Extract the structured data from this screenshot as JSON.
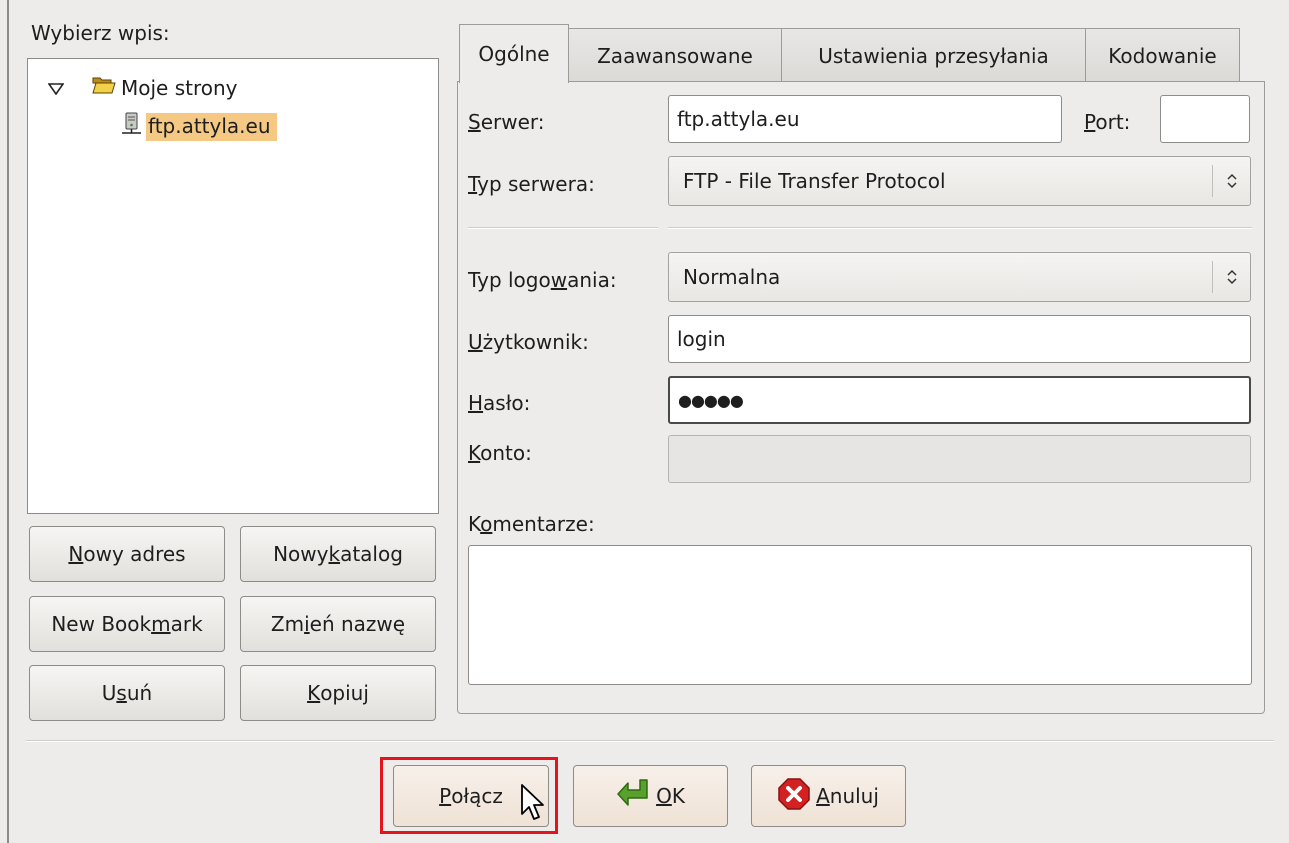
{
  "tree": {
    "heading": "Wybierz wpis:",
    "root": {
      "label": "Moje strony",
      "expanded": true
    },
    "site": {
      "label": "ftp.attyla.eu",
      "selected": true
    }
  },
  "buttons": {
    "new_site": {
      "pre": "",
      "u": "N",
      "post": "owy adres"
    },
    "new_folder": {
      "pre": "Nowy ",
      "u": "k",
      "post": "atalog"
    },
    "new_bookmark": {
      "pre": "New Book",
      "u": "m",
      "post": "ark"
    },
    "rename": {
      "pre": "Zm",
      "u": "i",
      "post": "eń nazwę"
    },
    "delete": {
      "pre": "U",
      "u": "s",
      "post": "uń"
    },
    "copy": {
      "pre": "",
      "u": "K",
      "post": "opiuj"
    }
  },
  "tabs": [
    "Ogólne",
    "Zaawansowane",
    "Ustawienia przesyłania",
    "Kodowanie"
  ],
  "form": {
    "server_label": {
      "pre": "",
      "u": "S",
      "post": "erwer:"
    },
    "server_value": "ftp.attyla.eu",
    "port_label": {
      "pre": "",
      "u": "P",
      "post": "ort:"
    },
    "port_value": "",
    "server_type_label": {
      "pre": "",
      "u": "T",
      "post": "yp serwera:"
    },
    "server_type_value": "FTP - File Transfer Protocol",
    "logon_type_label": {
      "pre": "Typ logo",
      "u": "w",
      "post": "ania:"
    },
    "logon_type_value": "Normalna",
    "user_label": {
      "pre": "",
      "u": "U",
      "post": "żytkownik:"
    },
    "user_value": "login",
    "password_label": {
      "pre": "",
      "u": "H",
      "post": "asło:"
    },
    "password_value": "●●●●●",
    "account_label": {
      "pre": "",
      "u": "K",
      "post": "onto:"
    },
    "account_value": "",
    "comments_label": {
      "pre": "K",
      "u": "o",
      "post": "mentarze:"
    },
    "comments_value": ""
  },
  "dialog": {
    "connect": {
      "pre": "",
      "u": "P",
      "post": "ołącz"
    },
    "ok": {
      "pre": "",
      "u": "O",
      "post": "K"
    },
    "cancel": {
      "pre": "",
      "u": "A",
      "post": "nuluj"
    }
  },
  "colors": {
    "selection": "#f5c883",
    "highlight_box": "#e3141b",
    "ok_arrow": "#5aa02c",
    "cancel_icon": "#d32020"
  },
  "icons": [
    "expander-down-icon",
    "folder-open-icon",
    "server-icon",
    "arrow-left-icon",
    "cancel-icon",
    "mouse-pointer-icon"
  ]
}
